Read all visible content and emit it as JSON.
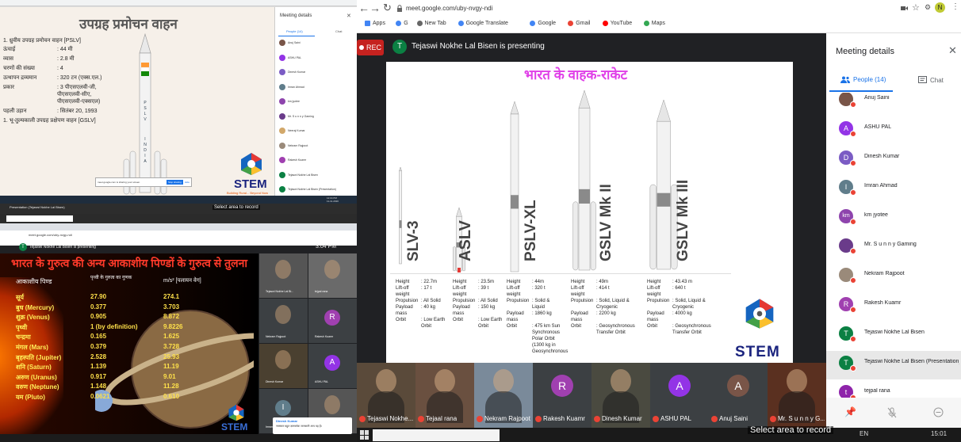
{
  "browser": {
    "url": "meet.google.com/uby-nvgy-ndi",
    "bookmarks": [
      "Apps",
      "G",
      "New Tab",
      "Google Translate",
      "Google",
      "Gmail",
      "YouTube",
      "Maps"
    ],
    "profile_initial": "N"
  },
  "meet": {
    "rec": "REC",
    "presenter_initial": "T",
    "presenting_text": "Tejaswi Nokhe Lal Bisen is presenting",
    "slide": {
      "title": "भारत के वाहक-राकेट",
      "brand": "STEM",
      "rockets": [
        {
          "name": "SLV-3",
          "specs": [
            [
              "Height",
              ": 22.7m"
            ],
            [
              "Lift-off weight",
              ": 17 t"
            ],
            [
              "Propulsion",
              ": All Solid"
            ],
            [
              "Payload mass",
              ": 40 kg"
            ],
            [
              "Orbit",
              ": Low Earth Orbit"
            ]
          ]
        },
        {
          "name": "ASLV",
          "specs": [
            [
              "Height",
              ": 23.5m"
            ],
            [
              "Lift-off weight",
              ": 39 t"
            ],
            [
              "Propulsion",
              ": All Solid"
            ],
            [
              "Payload mass",
              ": 150 kg"
            ],
            [
              "Orbit",
              ": Low Earth Orbit"
            ]
          ]
        },
        {
          "name": "PSLV-XL",
          "specs": [
            [
              "Height",
              ": 44m"
            ],
            [
              "Lift-off weight",
              ": 320 t"
            ],
            [
              "Propulsion",
              ": Solid & Liquid"
            ],
            [
              "Payload mass",
              ": 1860 kg"
            ],
            [
              "Orbit",
              ": 475 km Sun Synchronous Polar Orbit (1300 kg in Geosynchronous"
            ]
          ]
        },
        {
          "name": "GSLV Mk II",
          "specs": [
            [
              "Height",
              ": 49m"
            ],
            [
              "Lift-off weight",
              ": 414 t"
            ],
            [
              "Propulsion",
              ": Solid, Liquid & Cryogenic"
            ],
            [
              "Payload mass",
              ": 2200 kg"
            ],
            [
              "Orbit",
              ": Geosynchronous Transfer Orbit"
            ]
          ]
        },
        {
          "name": "GSLV Mk III",
          "specs": [
            [
              "Height",
              ": 43.43 m"
            ],
            [
              "Lift-off weight",
              ": 640 t"
            ],
            [
              "Propulsion",
              ": Solid, Liquid & Cryogenic"
            ],
            [
              "Payload mass",
              ": 4000 kg"
            ],
            [
              "Orbit",
              ": Geosynchronous Transfer Orbit"
            ]
          ]
        }
      ]
    },
    "tiles": [
      {
        "name": "Tejaswi Nokhe...",
        "initial": "",
        "photo": true,
        "color": "#5a4a3a"
      },
      {
        "name": "Tejaal rana",
        "initial": "",
        "photo": true,
        "color": "#6a5040"
      },
      {
        "name": "Nekram Rajpoot",
        "initial": "",
        "photo": true,
        "color": "#7a8a9a"
      },
      {
        "name": "Rakesh Kuamr",
        "initial": "R",
        "photo": false,
        "color": "#a040b0"
      },
      {
        "name": "Dinesh Kumar",
        "initial": "",
        "photo": true,
        "color": "#4a4a40"
      },
      {
        "name": "ASHU PAL",
        "initial": "A",
        "photo": false,
        "color": "#9334e6"
      },
      {
        "name": "Anuj Saini",
        "initial": "A",
        "photo": false,
        "color": "#795548"
      },
      {
        "name": "Mr. S u n n y G...",
        "initial": "",
        "photo": true,
        "color": "#5a3020"
      }
    ]
  },
  "panel": {
    "title": "Meeting details",
    "tab_people": "People (14)",
    "tab_chat": "Chat",
    "people": [
      {
        "name": "Anuj Saini",
        "initial": "",
        "color": "#795548"
      },
      {
        "name": "ASHU PAL",
        "initial": "A",
        "color": "#9334e6"
      },
      {
        "name": "Dinesh Kumar",
        "initial": "D",
        "color": "#7b5cc4"
      },
      {
        "name": "Imran Ahmad",
        "initial": "I",
        "color": "#607d8b"
      },
      {
        "name": "km jyotee",
        "initial": "km",
        "color": "#8e44ad"
      },
      {
        "name": "Mr. S u n n y Gaming",
        "initial": "",
        "color": "#6a3b8a"
      },
      {
        "name": "Nekram Rajpoot",
        "initial": "",
        "color": "#9a8a7a"
      },
      {
        "name": "Rakesh Kuamr",
        "initial": "R",
        "color": "#a040b0"
      },
      {
        "name": "Tejaswi Nokhe Lal Bisen",
        "initial": "T",
        "color": "#0b8043"
      },
      {
        "name": "Tejaswi Nokhe Lal Bisen (Presentation)",
        "initial": "T",
        "color": "#0b8043"
      },
      {
        "name": "tejpal rana",
        "initial": "t",
        "color": "#8e24aa"
      }
    ]
  },
  "taskbar_right": {
    "lang": "EN",
    "time": "15:01"
  },
  "composite": {
    "q1": {
      "title": "उपग्रह प्रमोचन वाहन",
      "lines": [
        {
          "k": "1. ध्रुवीय उपग्रह प्रमोचन वाहन [PSLV]",
          "v": ""
        },
        {
          "k": "ऊंचाई",
          "v": ": 44 मी"
        },
        {
          "k": "व्यास",
          "v": ": 2.8 मी"
        },
        {
          "k": "चरणों की संख्या",
          "v": ": 4"
        },
        {
          "k": "उत्थापन द्रव्यमान",
          "v": ": 320 टन (एक्स.एल.)"
        },
        {
          "k": "प्रकार",
          "v": ": 3 पीएसएलवी-जी, पीएसएलवी-सीए, पीएसएलवी-एक्सएल)"
        },
        {
          "k": "पहली उड़ान",
          "v": ": सितंबर 20, 1993"
        },
        {
          "k": "1. भू-तुल्यकाली उपग्रह प्रक्षेपण वाहन [GSLV]",
          "v": ""
        }
      ],
      "logo": "STEM",
      "tagline": "Building Rural... Beyond Now",
      "panel_title": "Meeting details",
      "panel_tab_people": "People (14)",
      "panel_tab_chat": "Chat",
      "panel_people": [
        "Anuj Saini",
        "ASHU PAL",
        "Dinesh Kumar",
        "Imran Ahmad",
        "km jyotee",
        "Mr. S u n n y Gaming",
        "Neeraj Kumar",
        "Nekram Rajpoot",
        "Rakesh Kuamr",
        "Tejaswi Nokhe Lal Bisen",
        "Tejaswi Nokhe Lal Bisen (Presentation)"
      ],
      "share_msg": "meet.google.com is sharing your screen.",
      "stop_btn": "Stop sharing",
      "hide_btn": "Hide",
      "taskbar_time": "12:04 PM",
      "taskbar_date": "11-11-2020"
    },
    "q2": {
      "tab_label": "Presentation (Tejaswi Nokhe Lal Bisen)",
      "select_area": "Select area to record",
      "search": "Type here to search",
      "url": "meet.google.com/uby-nvgy-ndi",
      "presenting": "Tejaswi Nokhe Lal Bisen is presenting",
      "slide_title": "भारत के गुरुत्व की अन्य आकाशीय पिण्डों के गुरुत्व से तुलना",
      "col1": "आकाशीय पिण्ड",
      "col2": "पृथ्वी के गुरुत्व का गुणक",
      "col3": "m/s² [पलायन वेग]",
      "rows": [
        [
          "सूर्य",
          "27.90",
          "274.1"
        ],
        [
          "बुध (Mercury)",
          "0.377",
          "3.703"
        ],
        [
          "शुक्र (Venus)",
          "0.905",
          "8.872"
        ],
        [
          "पृथ्वी",
          "1 (by definition)",
          "9.8226"
        ],
        [
          "चन्द्रमा",
          "0.165",
          "1.625"
        ],
        [
          "मंगल (Mars)",
          "0.379",
          "3.728"
        ],
        [
          "बृहस्पति (Jupiter)",
          "2.528",
          "25.93"
        ],
        [
          "शनि (Saturn)",
          "1.139",
          "11.19"
        ],
        [
          "अरुण (Uranus)",
          "0.917",
          "9.01"
        ],
        [
          "वरुण (Neptune)",
          "1.148",
          "11.28"
        ],
        [
          "यम (Pluto)",
          "0.0621",
          "0.610"
        ]
      ],
      "logo": "STEM",
      "time": "3:04 PM",
      "grid_names": [
        "Tejaswi Nokhe Lal Bi...",
        "tejpal rana",
        "Nekram Rajpoot",
        "Rakesh Kuamr",
        "Dinesh Kumar",
        "ASHU PAL",
        "Imran Ahmad",
        ""
      ],
      "notif_name": "Dinesh Kumar",
      "notif_msg": "नमस्कार बहुत ज्ञानवर्धक जानकारी आप यह हैं।"
    }
  }
}
